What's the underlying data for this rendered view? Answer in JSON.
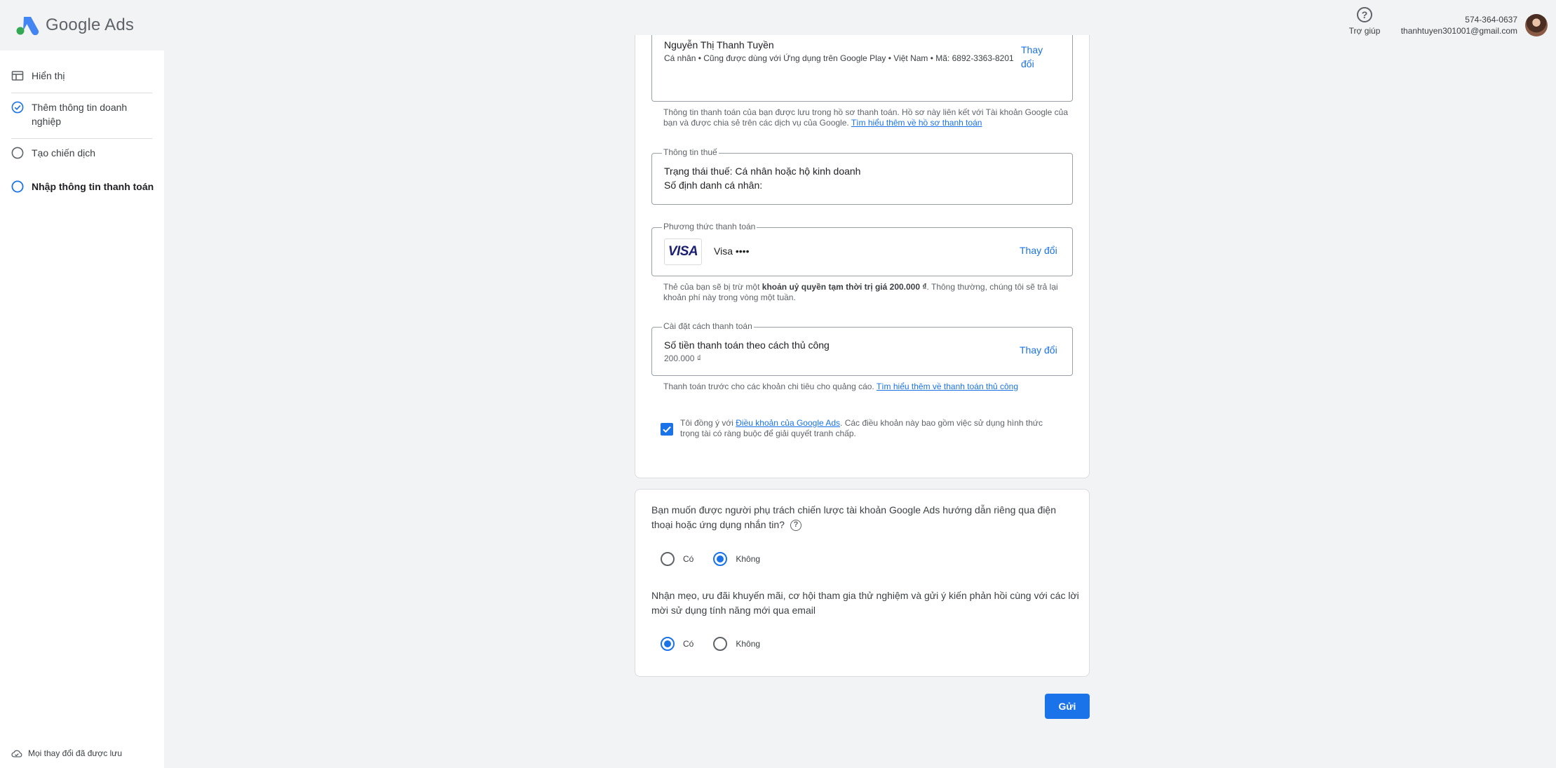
{
  "header": {
    "brand": "Google Ads",
    "help_label": "Trợ giúp",
    "phone": "574-364-0637",
    "email": "thanhtuyen301001@gmail.com"
  },
  "sidebar": {
    "items": [
      {
        "label": "Hiển thị",
        "icon": "display-icon",
        "state": "default"
      },
      {
        "label": "Thêm thông tin doanh nghiệp",
        "icon": "check-circle-icon",
        "state": "done"
      },
      {
        "label": "Tạo chiến dịch",
        "icon": "empty-circle-icon",
        "state": "todo"
      },
      {
        "label": "Nhập thông tin thanh toán",
        "icon": "blue-circle-icon",
        "state": "current"
      }
    ],
    "saved_label": "Mọi thay đổi đã được lưu"
  },
  "profile": {
    "name": "Nguyễn Thị Thanh Tuyền",
    "subtitle": "Cá nhân • Cũng được dùng với Ứng dụng trên Google Play • Việt Nam • Mã: 6892-3363-8201",
    "change": "Thay đổi",
    "note": "Thông tin thanh toán của bạn được lưu trong hồ sơ thanh toán. Hồ sơ này liên kết với Tài khoản Google của bạn và được chia sẻ trên các dịch vụ của Google.",
    "note_link": "Tìm hiểu thêm về hồ sơ thanh toán"
  },
  "tax": {
    "legend": "Thông tin thuế",
    "status": "Trạng thái thuế: Cá nhân hoặc hộ kinh doanh",
    "id_label": "Số định danh cá nhân:"
  },
  "payment": {
    "legend": "Phương thức thanh toán",
    "card_logo": "VISA",
    "card_text": "Visa ••••",
    "change": "Thay đổi",
    "note_a": "Thẻ của bạn sẽ bị trừ một ",
    "note_bold": "khoản uỷ quyền tạm thời trị giá 200.000 ₫",
    "note_b": ". Thông thường, chúng tôi sẽ trả lại khoản phí này trong vòng một tuần."
  },
  "settings": {
    "legend": "Cài đặt cách thanh toán",
    "title": "Số tiền thanh toán theo cách thủ công",
    "amount": "200.000 ₫",
    "change": "Thay đổi",
    "note": "Thanh toán trước cho các khoản chi tiêu cho quảng cáo.",
    "note_link": "Tìm hiểu thêm về thanh toán thủ công"
  },
  "agree": {
    "checked": true,
    "text_a": "Tôi đồng ý với ",
    "link": "Điều khoản của Google Ads",
    "text_b": ". Các điều khoản này bao gồm việc sử dụng hình thức trọng tài có ràng buộc để giải quyết tranh chấp."
  },
  "questions": [
    {
      "text": "Bạn muốn được người phụ trách chiến lược tài khoản Google Ads hướng dẫn riêng qua điện thoại hoặc ứng dụng nhắn tin?",
      "options": [
        "Có",
        "Không"
      ],
      "selected": "Không"
    },
    {
      "text": "Nhận mẹo, ưu đãi khuyến mãi, cơ hội tham gia thử nghiệm và gửi ý kiến phản hồi cùng với các lời mời sử dụng tính năng mới qua email",
      "options": [
        "Có",
        "Không"
      ],
      "selected": "Có"
    }
  ],
  "submit_label": "Gửi",
  "colors": {
    "accent": "#1a73e8",
    "background": "#f1f3f4"
  }
}
